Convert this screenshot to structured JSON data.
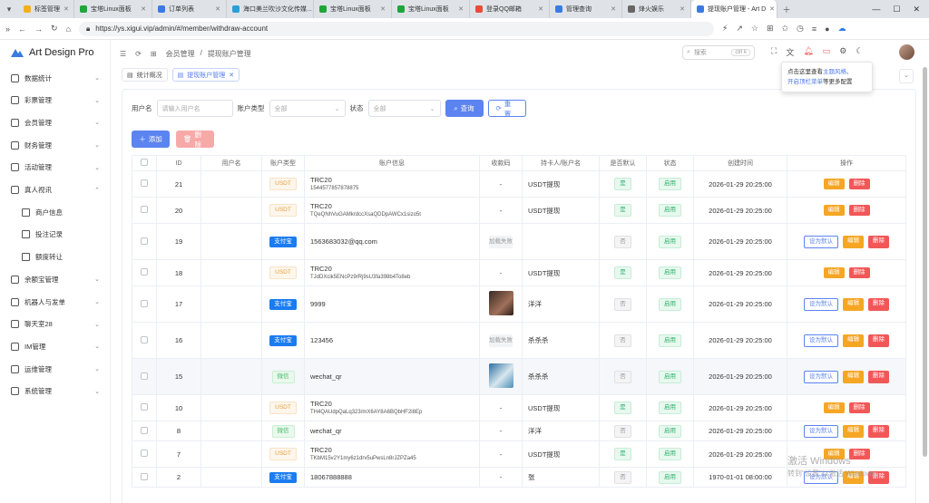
{
  "browser": {
    "tabs": [
      {
        "label": "标签管理",
        "color": "#f2b01e"
      },
      {
        "label": "宝塔Linux面板",
        "color": "#20a53a"
      },
      {
        "label": "订单列表",
        "color": "#3b7be0"
      },
      {
        "label": "海口美兰吹沙文化传媒...",
        "color": "#2a9fd6"
      },
      {
        "label": "宝塔Linux面板",
        "color": "#20a53a"
      },
      {
        "label": "宝塔Linux面板",
        "color": "#20a53a"
      },
      {
        "label": "登录QQ邮箱",
        "color": "#e84b3c"
      },
      {
        "label": "管理查询",
        "color": "#3b7be0"
      },
      {
        "label": "烽火娱乐",
        "color": "#666666"
      },
      {
        "label": "提现账户管理 - Art D",
        "color": "#3b7be0"
      }
    ],
    "url": "https://ys.xigui.vip/admin/#/member/withdraw-account"
  },
  "app": {
    "name": "Art Design Pro"
  },
  "sidebar": [
    {
      "label": "数据统计",
      "chev": "⌄"
    },
    {
      "label": "彩票管理",
      "chev": "⌄"
    },
    {
      "label": "会员管理",
      "chev": "⌄"
    },
    {
      "label": "财务管理",
      "chev": "⌄"
    },
    {
      "label": "活动管理",
      "chev": "⌄"
    },
    {
      "label": "真人视讯",
      "chev": "⌃"
    },
    {
      "label": "商户信息",
      "sub": true
    },
    {
      "label": "投注记录",
      "sub": true
    },
    {
      "label": "额度转让",
      "sub": true
    },
    {
      "label": "余额宝管理",
      "chev": "⌄"
    },
    {
      "label": "机器人与发单",
      "chev": "⌄"
    },
    {
      "label": "聊天室28",
      "chev": "⌄"
    },
    {
      "label": "IM管理",
      "chev": "⌄"
    },
    {
      "label": "运维管理",
      "chev": "⌄"
    },
    {
      "label": "系统管理",
      "chev": "⌄"
    }
  ],
  "breadcrumb": {
    "first": "会员管理",
    "sep": "/",
    "current": "提现账户管理"
  },
  "search": {
    "placeholder": "搜索",
    "shortcut": "ctrl k"
  },
  "page_tabs": [
    {
      "label": "统计概况"
    },
    {
      "label": "提现账户管理"
    }
  ],
  "tooltip": {
    "line1a": "点击这里查看",
    "line1link": "主题风格",
    "line1b": "、",
    "line2link": "开启顶栏菜单",
    "line2b": "等更多配置"
  },
  "filters": {
    "username_label": "用户名",
    "username_placeholder": "请输入用户名",
    "type_label": "账户类型",
    "type_value": "全部",
    "status_label": "状态",
    "status_value": "全部",
    "query_btn": "查询",
    "reset_btn": "重置"
  },
  "actions": {
    "add": "添加",
    "delete": "删除"
  },
  "table": {
    "headers": [
      "",
      "ID",
      "用户名",
      "账户类型",
      "账户信息",
      "收款码",
      "持卡人/账户名",
      "是否默认",
      "状态",
      "创建时间",
      "操作"
    ],
    "rows": [
      {
        "id": "21",
        "type": "USDT",
        "acc1": "TRC20",
        "acc2": "1544577857878875",
        "qr": "-",
        "holder": "USDT提现",
        "def": "是",
        "status": "启用",
        "time": "2026-01-29 20:25:00",
        "setdef": false
      },
      {
        "id": "20",
        "type": "USDT",
        "acc1": "TRC20",
        "acc2": "TQeQNhVuGAMkrdccXsaQDDpAWCx1sizo5t",
        "qr": "-",
        "holder": "USDT提现",
        "def": "是",
        "status": "启用",
        "time": "2026-01-29 20:25:00",
        "setdef": false
      },
      {
        "id": "19",
        "type": "支付宝",
        "acc1": "1563683032@qq.com",
        "acc2": "",
        "qr": "加载失败",
        "holder": "",
        "def": "否",
        "status": "启用",
        "time": "2026-01-29 20:25:00",
        "setdef": true
      },
      {
        "id": "18",
        "type": "USDT",
        "acc1": "TRC20",
        "acc2": "TJdDXcik5ENcPz9rRj9sU3fa398b4To8eb",
        "qr": "-",
        "holder": "USDT提现",
        "def": "是",
        "status": "启用",
        "time": "2026-01-29 20:25:00",
        "setdef": false
      },
      {
        "id": "17",
        "type": "支付宝",
        "acc1": "9999",
        "acc2": "",
        "qr": "img-a",
        "holder": "洋洋",
        "def": "否",
        "status": "启用",
        "time": "2026-01-29 20:25:00",
        "setdef": true
      },
      {
        "id": "16",
        "type": "支付宝",
        "acc1": "123456",
        "acc2": "",
        "qr": "加载失败",
        "holder": "杀杀杀",
        "def": "否",
        "status": "启用",
        "time": "2026-01-29 20:25:00",
        "setdef": true
      },
      {
        "id": "15",
        "type": "微信",
        "acc1": "wechat_qr",
        "acc2": "",
        "qr": "img-b",
        "holder": "杀杀杀",
        "def": "否",
        "status": "启用",
        "time": "2026-01-29 20:25:00",
        "setdef": true,
        "hl": true
      },
      {
        "id": "10",
        "type": "USDT",
        "acc1": "TRC20",
        "acc2": "TH4QAUdpQaLq323/mX6AY8A6BQbHF2l8Ep",
        "qr": "-",
        "holder": "USDT提现",
        "def": "是",
        "status": "启用",
        "time": "2026-01-29 20:25:00",
        "setdef": false
      },
      {
        "id": "8",
        "type": "微信",
        "acc1": "wechat_qr",
        "acc2": "",
        "qr": "-",
        "holder": "洋洋",
        "def": "否",
        "status": "启用",
        "time": "2026-01-29 20:25:00",
        "setdef": true
      },
      {
        "id": "7",
        "type": "USDT",
        "acc1": "TRC20",
        "acc2": "TKbM15v2Y1my6z1drv5uPwsLn8rJZPZa45",
        "qr": "-",
        "holder": "USDT提现",
        "def": "是",
        "status": "启用",
        "time": "2026-01-29 20:25:00",
        "setdef": false
      },
      {
        "id": "2",
        "type": "支付宝",
        "acc1": "18067888888",
        "acc2": "",
        "qr": "-",
        "holder": "张",
        "def": "否",
        "status": "启用",
        "time": "1970-01-01 08:00:00",
        "setdef": true
      }
    ],
    "op_setdef": "设为默认",
    "op_edit": "编辑",
    "op_delete": "删除"
  },
  "watermark": {
    "line1": "激活 Windows",
    "line2": "转到\"设置\"以激活 Windows。"
  }
}
